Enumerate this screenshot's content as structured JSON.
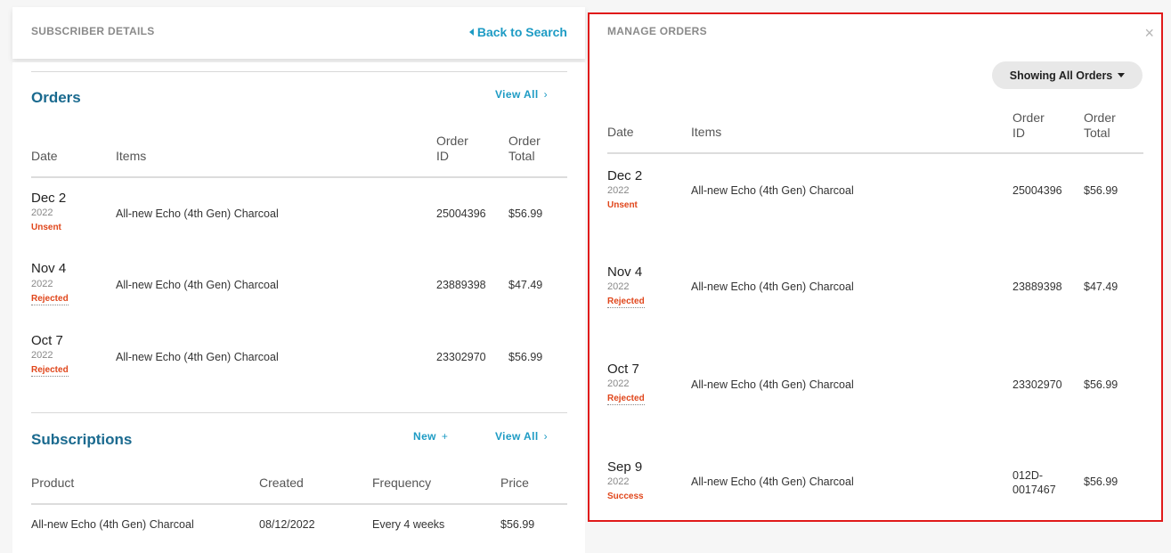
{
  "subscriber": {
    "title": "SUBSCRIBER DETAILS",
    "back_label": "Back to Search"
  },
  "orders": {
    "title": "Orders",
    "view_all": "View All",
    "view_all_chev": "›",
    "columns": {
      "date": "Date",
      "items": "Items",
      "order_id_1": "Order",
      "order_id_2": "ID",
      "total_1": "Order",
      "total_2": "Total"
    },
    "rows": [
      {
        "day": "Dec 2",
        "year": "2022",
        "status": "Unsent",
        "item": "All-new Echo (4th Gen) Charcoal",
        "id": "25004396",
        "total": "$56.99"
      },
      {
        "day": "Nov 4",
        "year": "2022",
        "status": "Rejected",
        "item": "All-new Echo (4th Gen) Charcoal",
        "id": "23889398",
        "total": "$47.49"
      },
      {
        "day": "Oct 7",
        "year": "2022",
        "status": "Rejected",
        "item": "All-new Echo (4th Gen) Charcoal",
        "id": "23302970",
        "total": "$56.99"
      }
    ]
  },
  "subscriptions": {
    "title": "Subscriptions",
    "new_label": "New",
    "new_plus": "+",
    "view_all": "View All",
    "view_all_chev": "›",
    "columns": {
      "product": "Product",
      "created": "Created",
      "frequency": "Frequency",
      "price": "Price"
    },
    "rows": [
      {
        "product": "All-new Echo (4th Gen) Charcoal",
        "created": "08/12/2022",
        "frequency": "Every 4 weeks",
        "price": "$56.99"
      }
    ]
  },
  "manage": {
    "title": "MANAGE ORDERS",
    "close_glyph": "×",
    "filter_label": "Showing All Orders",
    "columns": {
      "date": "Date",
      "items": "Items",
      "order_id_1": "Order",
      "order_id_2": "ID",
      "total_1": "Order",
      "total_2": "Total"
    },
    "rows": [
      {
        "day": "Dec 2",
        "year": "2022",
        "status": "Unsent",
        "item": "All-new Echo (4th Gen) Charcoal",
        "id": "25004396",
        "id_2": "",
        "total": "$56.99"
      },
      {
        "day": "Nov 4",
        "year": "2022",
        "status": "Rejected",
        "item": "All-new Echo (4th Gen) Charcoal",
        "id": "23889398",
        "id_2": "",
        "total": "$47.49"
      },
      {
        "day": "Oct 7",
        "year": "2022",
        "status": "Rejected",
        "item": "All-new Echo (4th Gen) Charcoal",
        "id": "23302970",
        "id_2": "",
        "total": "$56.99"
      },
      {
        "day": "Sep 9",
        "year": "2022",
        "status": "Success",
        "item": "All-new Echo (4th Gen) Charcoal",
        "id": "012D-",
        "id_2": "0017467",
        "total": "$56.99"
      }
    ]
  },
  "colors": {
    "accent": "#1d9bc4",
    "heading": "#1a6a8f",
    "status": "#e0461b",
    "highlight_border": "#e01a1a"
  }
}
